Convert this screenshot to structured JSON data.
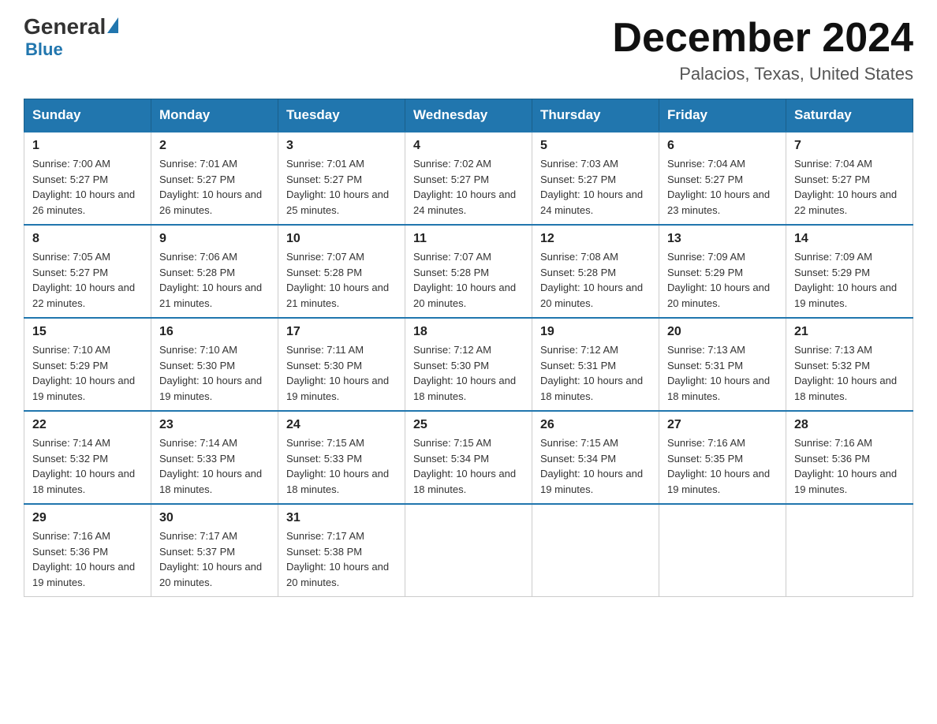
{
  "header": {
    "logo_general": "General",
    "logo_blue": "Blue",
    "month_title": "December 2024",
    "location": "Palacios, Texas, United States"
  },
  "days_of_week": [
    "Sunday",
    "Monday",
    "Tuesday",
    "Wednesday",
    "Thursday",
    "Friday",
    "Saturday"
  ],
  "weeks": [
    [
      {
        "day": "1",
        "sunrise": "7:00 AM",
        "sunset": "5:27 PM",
        "daylight": "10 hours and 26 minutes."
      },
      {
        "day": "2",
        "sunrise": "7:01 AM",
        "sunset": "5:27 PM",
        "daylight": "10 hours and 26 minutes."
      },
      {
        "day": "3",
        "sunrise": "7:01 AM",
        "sunset": "5:27 PM",
        "daylight": "10 hours and 25 minutes."
      },
      {
        "day": "4",
        "sunrise": "7:02 AM",
        "sunset": "5:27 PM",
        "daylight": "10 hours and 24 minutes."
      },
      {
        "day": "5",
        "sunrise": "7:03 AM",
        "sunset": "5:27 PM",
        "daylight": "10 hours and 24 minutes."
      },
      {
        "day": "6",
        "sunrise": "7:04 AM",
        "sunset": "5:27 PM",
        "daylight": "10 hours and 23 minutes."
      },
      {
        "day": "7",
        "sunrise": "7:04 AM",
        "sunset": "5:27 PM",
        "daylight": "10 hours and 22 minutes."
      }
    ],
    [
      {
        "day": "8",
        "sunrise": "7:05 AM",
        "sunset": "5:27 PM",
        "daylight": "10 hours and 22 minutes."
      },
      {
        "day": "9",
        "sunrise": "7:06 AM",
        "sunset": "5:28 PM",
        "daylight": "10 hours and 21 minutes."
      },
      {
        "day": "10",
        "sunrise": "7:07 AM",
        "sunset": "5:28 PM",
        "daylight": "10 hours and 21 minutes."
      },
      {
        "day": "11",
        "sunrise": "7:07 AM",
        "sunset": "5:28 PM",
        "daylight": "10 hours and 20 minutes."
      },
      {
        "day": "12",
        "sunrise": "7:08 AM",
        "sunset": "5:28 PM",
        "daylight": "10 hours and 20 minutes."
      },
      {
        "day": "13",
        "sunrise": "7:09 AM",
        "sunset": "5:29 PM",
        "daylight": "10 hours and 20 minutes."
      },
      {
        "day": "14",
        "sunrise": "7:09 AM",
        "sunset": "5:29 PM",
        "daylight": "10 hours and 19 minutes."
      }
    ],
    [
      {
        "day": "15",
        "sunrise": "7:10 AM",
        "sunset": "5:29 PM",
        "daylight": "10 hours and 19 minutes."
      },
      {
        "day": "16",
        "sunrise": "7:10 AM",
        "sunset": "5:30 PM",
        "daylight": "10 hours and 19 minutes."
      },
      {
        "day": "17",
        "sunrise": "7:11 AM",
        "sunset": "5:30 PM",
        "daylight": "10 hours and 19 minutes."
      },
      {
        "day": "18",
        "sunrise": "7:12 AM",
        "sunset": "5:30 PM",
        "daylight": "10 hours and 18 minutes."
      },
      {
        "day": "19",
        "sunrise": "7:12 AM",
        "sunset": "5:31 PM",
        "daylight": "10 hours and 18 minutes."
      },
      {
        "day": "20",
        "sunrise": "7:13 AM",
        "sunset": "5:31 PM",
        "daylight": "10 hours and 18 minutes."
      },
      {
        "day": "21",
        "sunrise": "7:13 AM",
        "sunset": "5:32 PM",
        "daylight": "10 hours and 18 minutes."
      }
    ],
    [
      {
        "day": "22",
        "sunrise": "7:14 AM",
        "sunset": "5:32 PM",
        "daylight": "10 hours and 18 minutes."
      },
      {
        "day": "23",
        "sunrise": "7:14 AM",
        "sunset": "5:33 PM",
        "daylight": "10 hours and 18 minutes."
      },
      {
        "day": "24",
        "sunrise": "7:15 AM",
        "sunset": "5:33 PM",
        "daylight": "10 hours and 18 minutes."
      },
      {
        "day": "25",
        "sunrise": "7:15 AM",
        "sunset": "5:34 PM",
        "daylight": "10 hours and 18 minutes."
      },
      {
        "day": "26",
        "sunrise": "7:15 AM",
        "sunset": "5:34 PM",
        "daylight": "10 hours and 19 minutes."
      },
      {
        "day": "27",
        "sunrise": "7:16 AM",
        "sunset": "5:35 PM",
        "daylight": "10 hours and 19 minutes."
      },
      {
        "day": "28",
        "sunrise": "7:16 AM",
        "sunset": "5:36 PM",
        "daylight": "10 hours and 19 minutes."
      }
    ],
    [
      {
        "day": "29",
        "sunrise": "7:16 AM",
        "sunset": "5:36 PM",
        "daylight": "10 hours and 19 minutes."
      },
      {
        "day": "30",
        "sunrise": "7:17 AM",
        "sunset": "5:37 PM",
        "daylight": "10 hours and 20 minutes."
      },
      {
        "day": "31",
        "sunrise": "7:17 AM",
        "sunset": "5:38 PM",
        "daylight": "10 hours and 20 minutes."
      },
      null,
      null,
      null,
      null
    ]
  ],
  "labels": {
    "sunrise_prefix": "Sunrise: ",
    "sunset_prefix": "Sunset: ",
    "daylight_prefix": "Daylight: "
  }
}
